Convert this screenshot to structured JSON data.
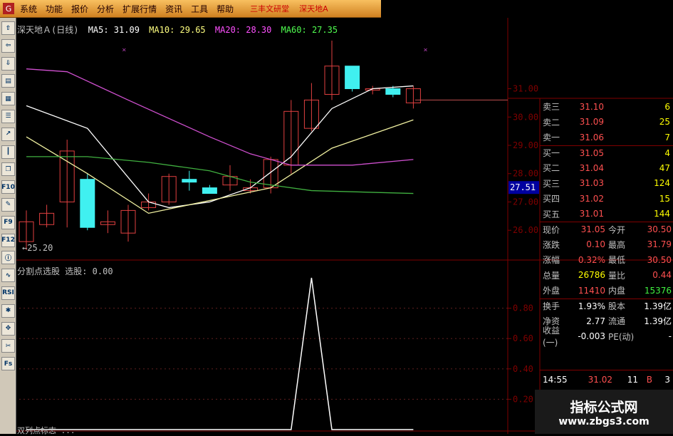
{
  "colors": {
    "up": "#e04040",
    "down": "#40f0f0",
    "ma5": "#ffffff",
    "ma10": "#f0f0a0",
    "ma20": "#d050d0",
    "ma60": "#40b040",
    "grid": "#800000",
    "price_line": "#c05050"
  },
  "menu": {
    "items": [
      "系统",
      "功能",
      "报价",
      "分析",
      "扩展行情",
      "资讯",
      "工具",
      "帮助"
    ],
    "right": [
      "三丰文研堂",
      "深天地A"
    ]
  },
  "toolbar": {
    "icons": [
      {
        "name": "up-arrow-icon",
        "glyph": "⇧"
      },
      {
        "name": "left-arrow-icon",
        "glyph": "⇦"
      },
      {
        "name": "down-arrow-icon",
        "glyph": "⇩"
      },
      {
        "name": "report-icon",
        "glyph": "▤"
      },
      {
        "name": "grid-icon",
        "glyph": "▦"
      },
      {
        "name": "list-icon",
        "glyph": "☰"
      },
      {
        "name": "line-chart-icon",
        "glyph": "↗"
      },
      {
        "name": "kline-icon",
        "glyph": "┃"
      },
      {
        "name": "copy-icon",
        "glyph": "❐"
      },
      {
        "name": "f10-icon",
        "glyph": "F10"
      },
      {
        "name": "edit-icon",
        "glyph": "✎"
      },
      {
        "name": "f9-icon",
        "glyph": "F9"
      },
      {
        "name": "f12-icon",
        "glyph": "F12"
      },
      {
        "name": "info-icon",
        "glyph": "ⓘ"
      },
      {
        "name": "rsi-wave-icon",
        "glyph": "∿"
      },
      {
        "name": "rsi-icon",
        "glyph": "RSI"
      },
      {
        "name": "tools-icon",
        "glyph": "✱"
      },
      {
        "name": "move-icon",
        "glyph": "✥"
      },
      {
        "name": "scissors-icon",
        "glyph": "✂"
      },
      {
        "name": "fs-icon",
        "glyph": "Fs"
      }
    ]
  },
  "title": {
    "name": "深天地Ａ(日线)",
    "ma5": "MA5: 31.09",
    "ma10": "MA10: 29.65",
    "ma20": "MA20: 28.30",
    "ma60": "MA60: 27.35"
  },
  "price_axis": [
    "31.00",
    "30.00",
    "29.00",
    "28.00",
    "27.00",
    "26.00"
  ],
  "price_marker": "27.51",
  "min_label": "←25.20",
  "indicator": {
    "title": "分割点选股 选股: 0.00",
    "axis": [
      "0.80",
      "0.60",
      "0.40",
      "0.20"
    ]
  },
  "bottom_text": "双列点标志 ...",
  "chart_data": {
    "type": "candlestick",
    "candles": [
      {
        "o": 25.6,
        "c": 26.3,
        "h": 26.7,
        "l": 25.3
      },
      {
        "o": 26.2,
        "c": 26.6,
        "h": 26.9,
        "l": 26.1
      },
      {
        "o": 27.0,
        "c": 28.8,
        "h": 29.2,
        "l": 26.1
      },
      {
        "o": 27.8,
        "c": 26.1,
        "h": 28.0,
        "l": 26.0
      },
      {
        "o": 26.2,
        "c": 26.3,
        "h": 26.7,
        "l": 25.9
      },
      {
        "o": 25.9,
        "c": 26.7,
        "h": 26.9,
        "l": 25.6
      },
      {
        "o": 26.8,
        "c": 27.0,
        "h": 27.3,
        "l": 26.7
      },
      {
        "o": 27.0,
        "c": 27.9,
        "h": 28.0,
        "l": 26.9
      },
      {
        "o": 27.8,
        "c": 27.7,
        "h": 28.1,
        "l": 27.4
      },
      {
        "o": 27.5,
        "c": 27.3,
        "h": 27.6,
        "l": 27.3
      },
      {
        "o": 27.6,
        "c": 27.9,
        "h": 28.3,
        "l": 27.4
      },
      {
        "o": 27.4,
        "c": 27.5,
        "h": 27.8,
        "l": 27.3
      },
      {
        "o": 27.5,
        "c": 28.5,
        "h": 28.6,
        "l": 27.3
      },
      {
        "o": 28.3,
        "c": 30.2,
        "h": 30.6,
        "l": 28.0
      },
      {
        "o": 29.6,
        "c": 30.6,
        "h": 31.2,
        "l": 29.5
      },
      {
        "o": 30.8,
        "c": 31.8,
        "h": 32.7,
        "l": 30.6
      },
      {
        "o": 31.8,
        "c": 31.0,
        "h": 31.8,
        "l": 30.9
      },
      {
        "o": 31.0,
        "c": 31.0,
        "h": 31.1,
        "l": 30.8
      },
      {
        "o": 31.0,
        "c": 30.8,
        "h": 31.1,
        "l": 30.7
      },
      {
        "o": 30.5,
        "c": 31.0,
        "h": 31.1,
        "l": 30.3
      }
    ],
    "ma5": [
      [
        0,
        30.4
      ],
      [
        3,
        29.6
      ],
      [
        6,
        27.0
      ],
      [
        7,
        26.8
      ],
      [
        9,
        27.0
      ],
      [
        11,
        27.5
      ],
      [
        13,
        28.6
      ],
      [
        15,
        30.3
      ],
      [
        17,
        31.0
      ],
      [
        19,
        31.1
      ]
    ],
    "ma10": [
      [
        0,
        29.3
      ],
      [
        3,
        28.0
      ],
      [
        6,
        26.6
      ],
      [
        8,
        26.9
      ],
      [
        10,
        27.2
      ],
      [
        12,
        27.5
      ],
      [
        15,
        28.9
      ],
      [
        17,
        29.4
      ],
      [
        19,
        29.9
      ]
    ],
    "ma20": [
      [
        0,
        31.7
      ],
      [
        2,
        31.6
      ],
      [
        5,
        30.6
      ],
      [
        9,
        29.3
      ],
      [
        11,
        28.7
      ],
      [
        13,
        28.3
      ],
      [
        16,
        28.3
      ],
      [
        19,
        28.5
      ]
    ],
    "ma60": [
      [
        0,
        28.6
      ],
      [
        3,
        28.6
      ],
      [
        6,
        28.4
      ],
      [
        9,
        28.1
      ],
      [
        11,
        27.7
      ],
      [
        14,
        27.4
      ],
      [
        19,
        27.3
      ]
    ],
    "ylim": [
      25.2,
      32.8
    ],
    "signal": [
      0,
      0,
      0,
      0,
      0,
      0,
      0,
      0,
      0,
      0,
      0,
      0,
      0,
      0,
      1,
      0,
      0,
      0,
      0,
      0
    ]
  },
  "quotes": [
    {
      "label": "卖三",
      "price": "31.10",
      "vol": "6"
    },
    {
      "label": "卖二",
      "price": "31.09",
      "vol": "25"
    },
    {
      "label": "卖一",
      "price": "31.06",
      "vol": "7"
    },
    {
      "label": "买一",
      "price": "31.05",
      "vol": "4"
    },
    {
      "label": "买二",
      "price": "31.04",
      "vol": "47"
    },
    {
      "label": "买三",
      "price": "31.03",
      "vol": "124"
    },
    {
      "label": "买四",
      "price": "31.02",
      "vol": "15"
    },
    {
      "label": "买五",
      "price": "31.01",
      "vol": "144"
    }
  ],
  "stats": [
    {
      "a": "现价",
      "b": "31.05",
      "c": "今开",
      "d": "30.50"
    },
    {
      "a": "涨跌",
      "b": "0.10",
      "c": "最高",
      "d": "31.79"
    },
    {
      "a": "涨幅",
      "b": "0.32%",
      "c": "最低",
      "d": "30.50"
    },
    {
      "a": "总量",
      "b": "26786",
      "c": "量比",
      "d": "0.44"
    },
    {
      "a": "外盘",
      "b": "11410",
      "c": "内盘",
      "d": "15376"
    },
    {
      "a": "换手",
      "b": "1.93%",
      "c": "股本",
      "d": "1.39亿"
    },
    {
      "a": "净资",
      "b": "2.77",
      "c": "流通",
      "d": "1.39亿"
    },
    {
      "a": "收益(一)",
      "b": "-0.003",
      "c": "PE(动)",
      "d": "-"
    }
  ],
  "tick": {
    "time": "14:55",
    "price": "31.02",
    "vol": "11",
    "side": "B",
    "n": "3"
  },
  "watermark": {
    "line1": "指标公式网",
    "line2": "www.zbgs3.com"
  }
}
